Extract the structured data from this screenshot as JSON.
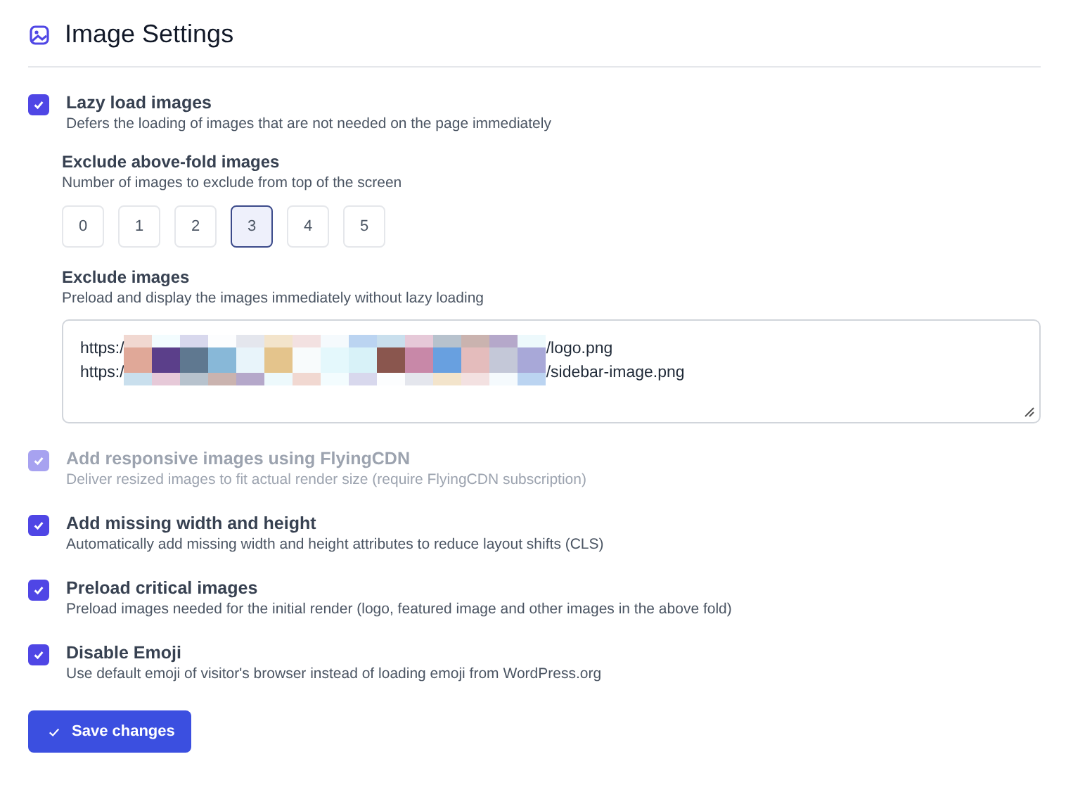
{
  "title": "Image Settings",
  "lazy_load": {
    "label": "Lazy load images",
    "description": "Defers the loading of images that are not needed on the page immediately",
    "checked": true,
    "disabled": false
  },
  "exclude_above_fold": {
    "label": "Exclude above-fold images",
    "description": "Number of images to exclude from top of the screen",
    "choices": [
      {
        "label": "0",
        "selected": false
      },
      {
        "label": "1",
        "selected": false
      },
      {
        "label": "2",
        "selected": false
      },
      {
        "label": "3",
        "selected": true
      },
      {
        "label": "4",
        "selected": false
      },
      {
        "label": "5",
        "selected": false
      }
    ]
  },
  "exclude_images": {
    "label": "Exclude images",
    "description": "Preload and display the images immediately without lazy loading",
    "lines": [
      {
        "prefix": "https:/",
        "suffix": "/logo.png"
      },
      {
        "prefix": "https:/",
        "suffix": "/sidebar-image.png"
      }
    ]
  },
  "options": [
    {
      "label": "Add responsive images using FlyingCDN",
      "description": "Deliver resized images to fit actual render size (require FlyingCDN subscription)",
      "checked": true,
      "disabled": true
    },
    {
      "label": "Add missing width and height",
      "description": "Automatically add missing width and height attributes to reduce layout shifts (CLS)",
      "checked": true,
      "disabled": false
    },
    {
      "label": "Preload critical images",
      "description": "Preload images needed for the initial render (logo, featured image and other images in the above fold)",
      "checked": true,
      "disabled": false
    },
    {
      "label": "Disable Emoji",
      "description": "Use default emoji of visitor's browser instead of loading emoji from WordPress.org",
      "checked": true,
      "disabled": false
    }
  ],
  "save_button": {
    "label": "Save changes"
  }
}
